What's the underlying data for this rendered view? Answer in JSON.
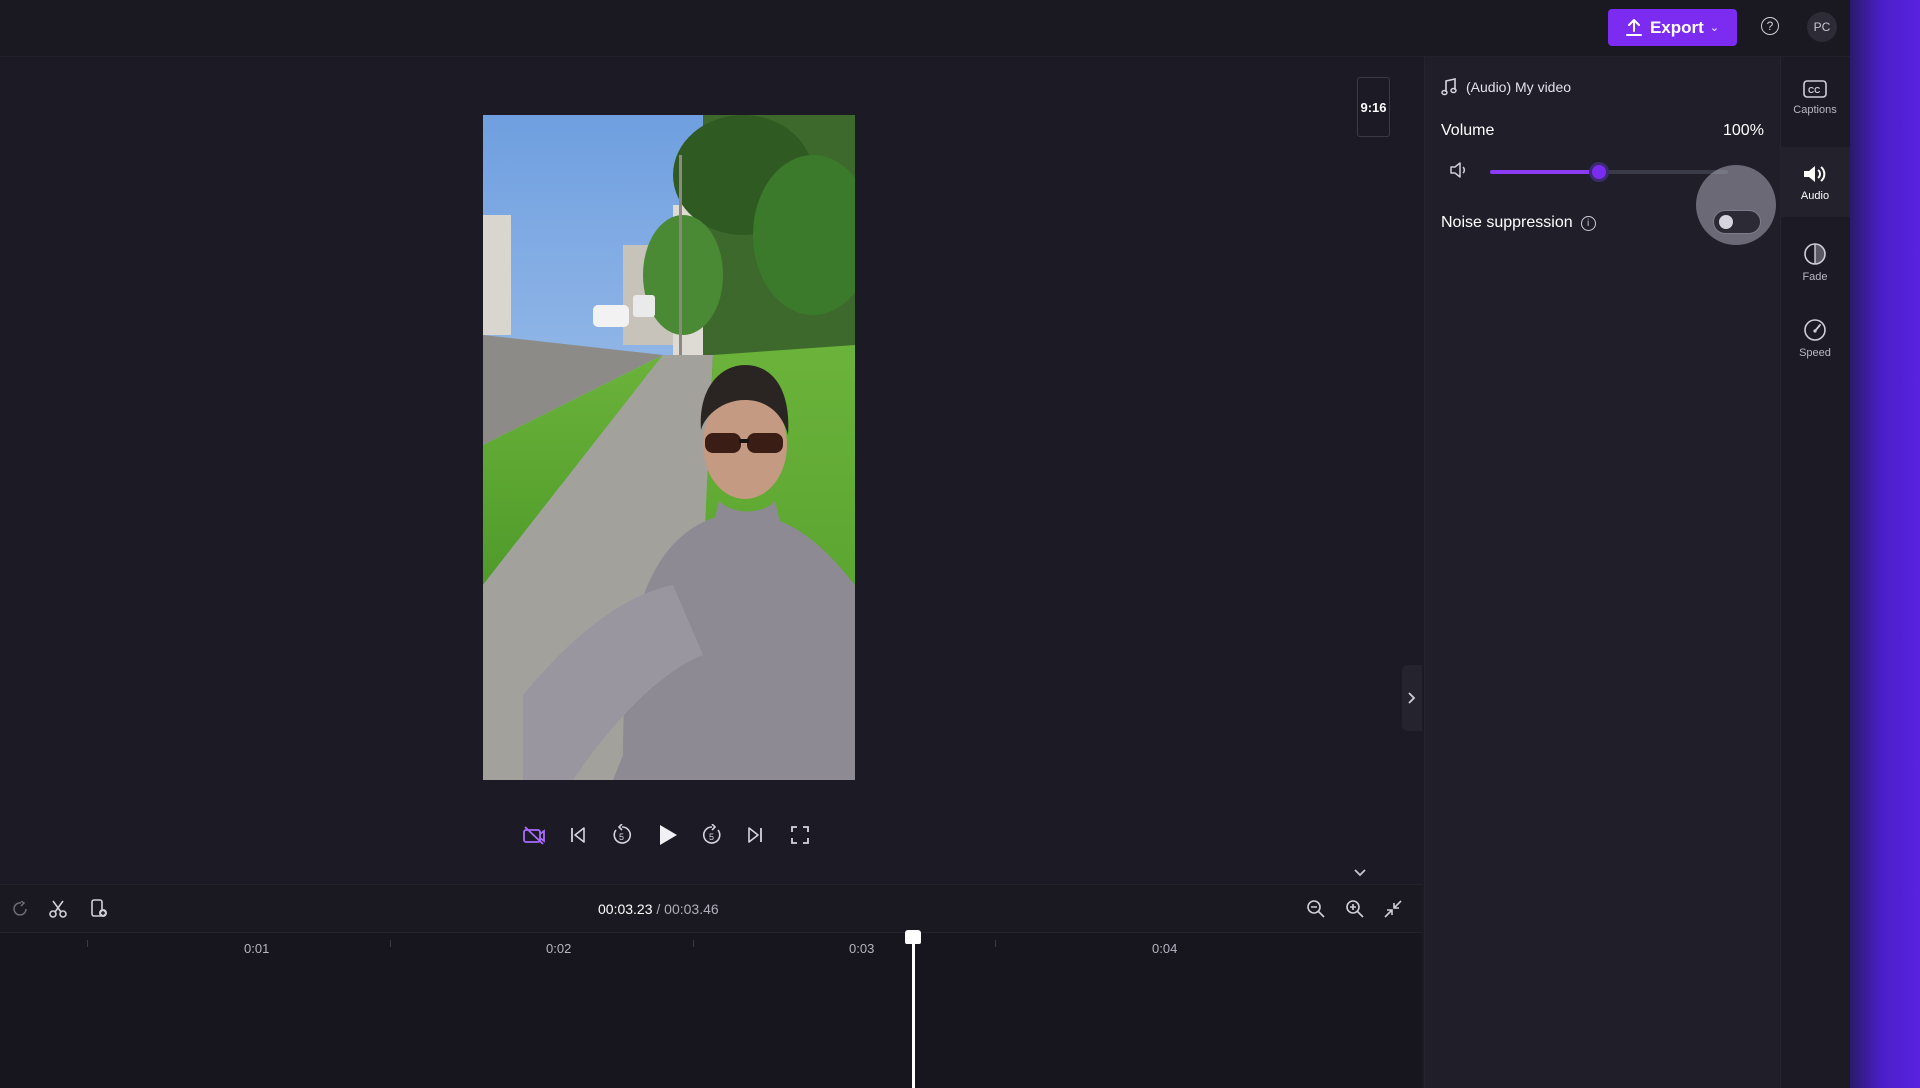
{
  "topbar": {
    "export_label": "Export",
    "help_icon": "?",
    "avatar_initials": "PC"
  },
  "preview": {
    "aspect_ratio": "9:16"
  },
  "timeline": {
    "current_time": "00:03.23",
    "separator": "/",
    "total_time": "00:03.46",
    "ticks": [
      "0:01",
      "0:02",
      "0:03",
      "0:04"
    ]
  },
  "properties": {
    "audio_title": "(Audio) My video",
    "volume_label": "Volume",
    "volume_value": "100%",
    "volume_fraction": 0.46,
    "noise_label": "Noise suppression",
    "noise_enabled": false
  },
  "side_tabs": [
    {
      "label": "Captions",
      "icon": "captions-icon"
    },
    {
      "label": "Audio",
      "icon": "speaker-icon"
    },
    {
      "label": "Fade",
      "icon": "fade-icon"
    },
    {
      "label": "Speed",
      "icon": "speedometer-icon"
    }
  ],
  "colors": {
    "accent": "#7b2cf0",
    "background": "#1c1b25"
  }
}
